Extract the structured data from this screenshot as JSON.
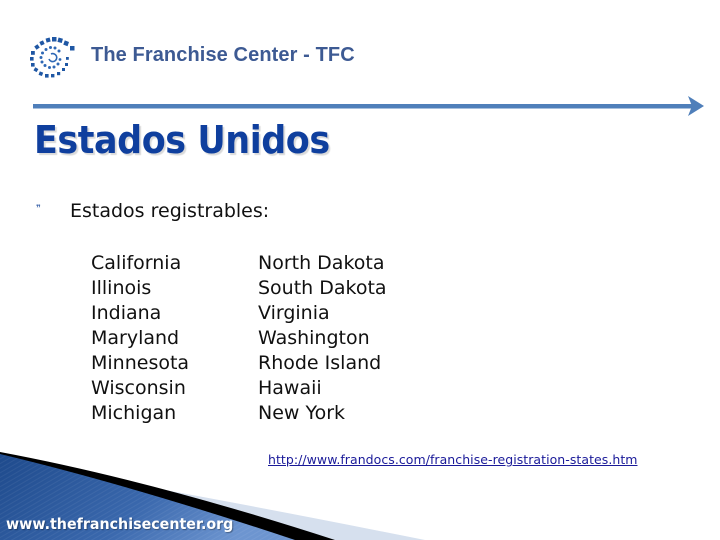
{
  "header": {
    "brand_title": "The Franchise Center - TFC",
    "logo_icon": "spiral-dots-logo-icon"
  },
  "divider": {
    "icon": "arrow-right-icon",
    "color": "#4f7fba"
  },
  "slide": {
    "title": "Estados Unidos",
    "title_color": "#0f3f9e",
    "bullet": {
      "icon": "bullet-quote-icon",
      "glyph": "❞",
      "text": "Estados registrables:"
    },
    "states_left": [
      "California",
      "Illinois",
      "Indiana",
      "Maryland",
      "Minnesota",
      "Wisconsin",
      "Michigan"
    ],
    "states_right": [
      "North Dakota",
      "South Dakota",
      "Virginia",
      "Washington",
      "Rhode Island",
      "Hawaii",
      "New York"
    ],
    "source_link": "http://www.frandocs.com/franchise-registration-states.htm"
  },
  "footer": {
    "url": "www.thefranchisecenter.org",
    "swoosh_colors": {
      "blue_dark": "#1e4a8c",
      "blue_light": "#5a86c8",
      "black": "#000000",
      "pale": "#d6e0ee"
    }
  }
}
